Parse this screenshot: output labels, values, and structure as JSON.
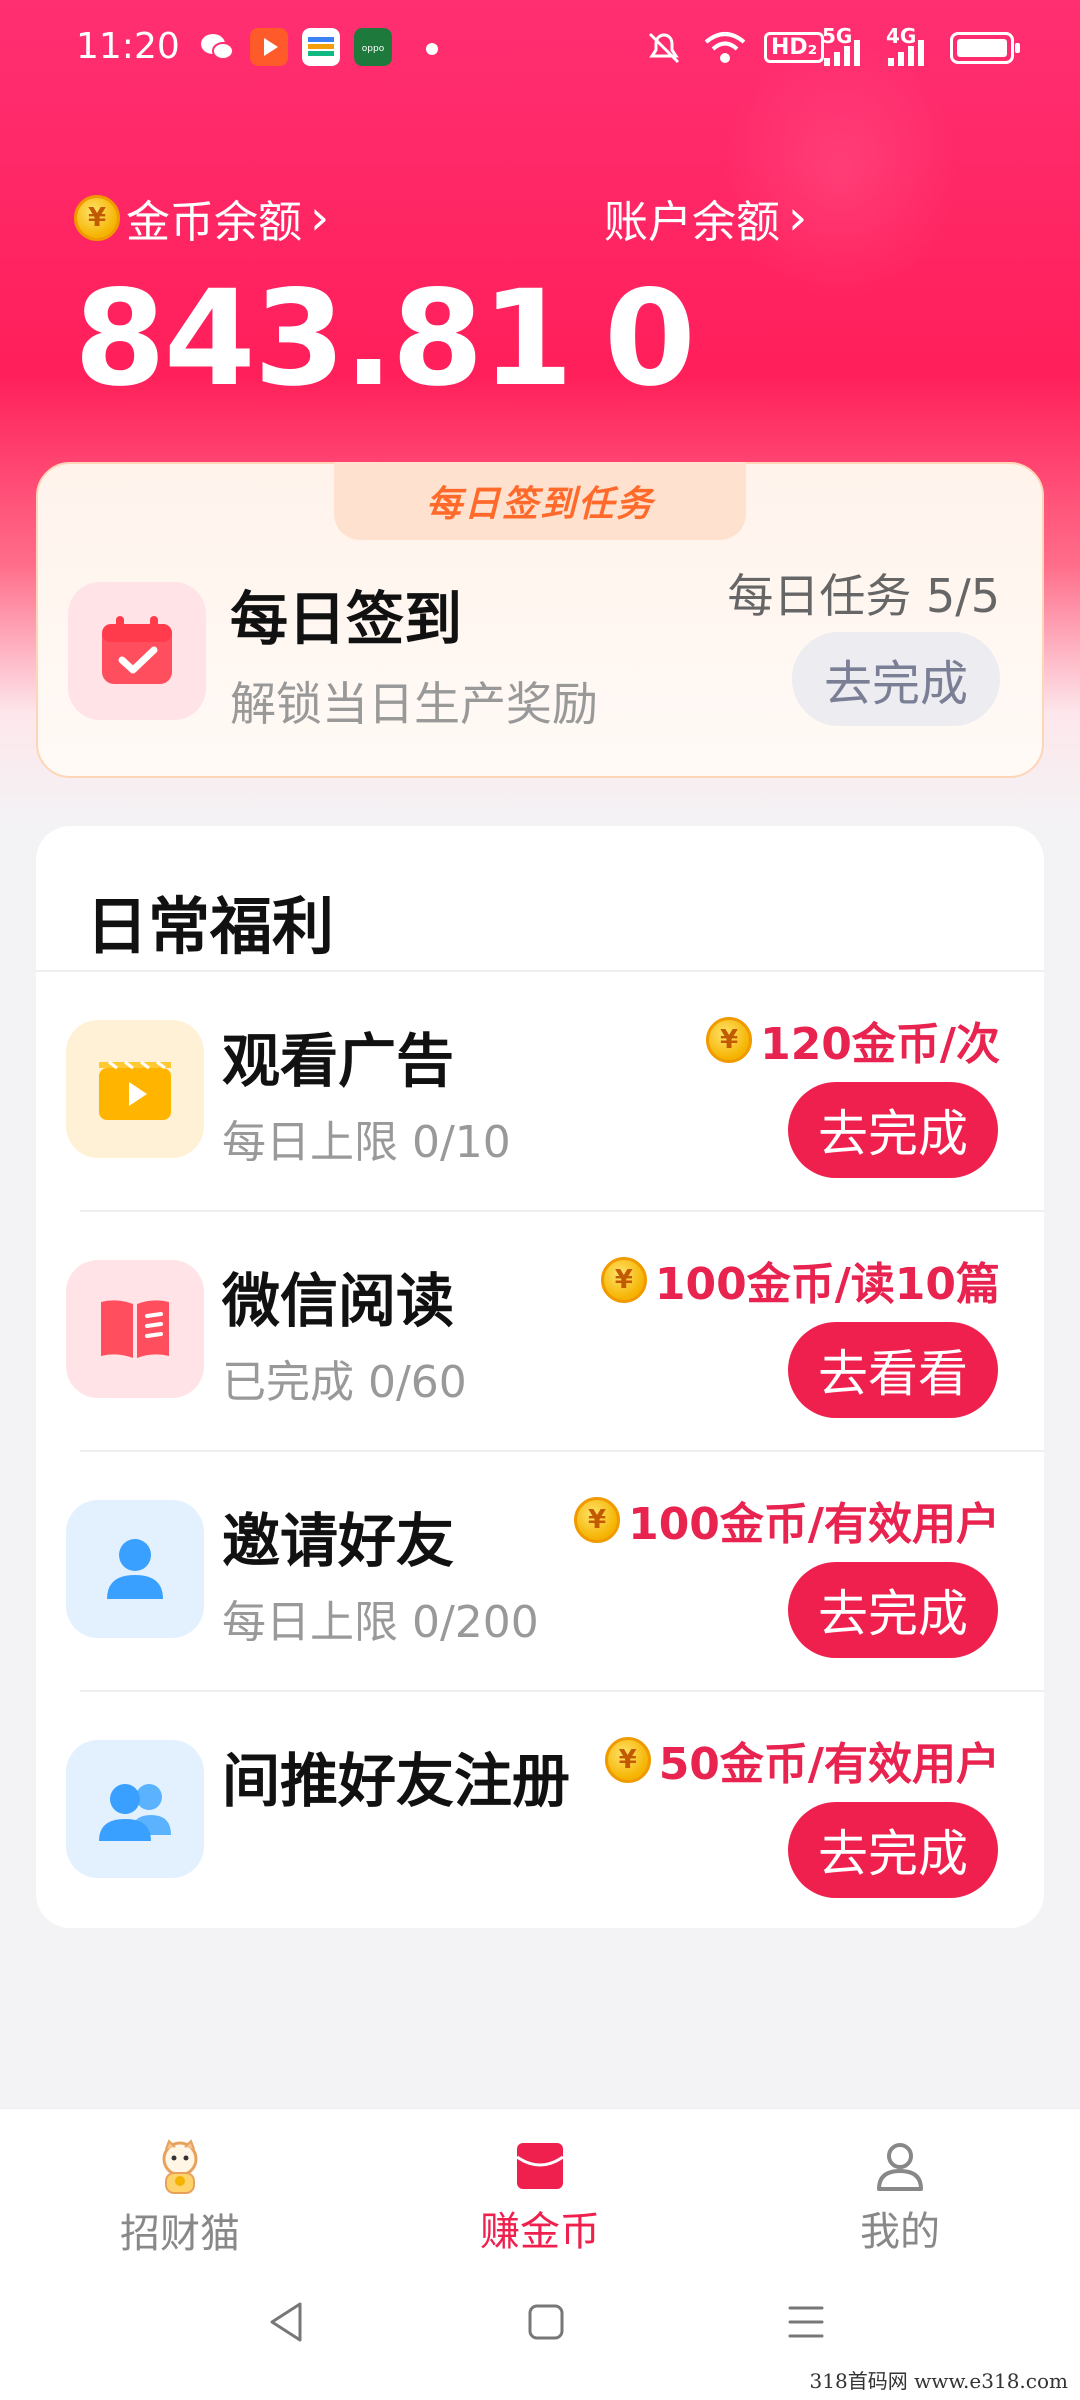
{
  "status_bar": {
    "time": "11:20",
    "indicators": [
      "HD₂",
      "5G",
      "4G"
    ],
    "apps": [
      "wechat",
      "video",
      "wallet",
      "oppo"
    ]
  },
  "balances": {
    "coin_label": "金币余额",
    "coin_value": "843.81",
    "account_label": "账户余额",
    "account_value": "0",
    "chevron": "›",
    "coin_symbol": "¥"
  },
  "daily_sign": {
    "banner": "每日签到任务",
    "title": "每日签到",
    "subtitle": "解锁当日生产奖励",
    "progress_text": "每日任务 5/5",
    "button": "去完成"
  },
  "welfare": {
    "title": "日常福利",
    "items": [
      {
        "title": "观看广告",
        "subtitle": "每日上限 0/10",
        "reward": "120金币/次",
        "button": "去完成",
        "icon": "video-icon",
        "icon_bg": "#fff1d6"
      },
      {
        "title": "微信阅读",
        "subtitle": "已完成 0/60",
        "reward": "100金币/读10篇",
        "button": "去看看",
        "icon": "book-icon",
        "icon_bg": "#ffe3e6"
      },
      {
        "title": "邀请好友",
        "subtitle": "每日上限 0/200",
        "reward": "100金币/有效用户",
        "button": "去完成",
        "icon": "user-icon",
        "icon_bg": "#e3f1ff"
      },
      {
        "title": "间推好友注册",
        "subtitle": "",
        "reward": "50金币/有效用户",
        "button": "去完成",
        "icon": "users-icon",
        "icon_bg": "#e3f1ff"
      }
    ]
  },
  "bottom_nav": {
    "items": [
      {
        "label": "招财猫",
        "icon": "lucky-cat-icon",
        "active": false
      },
      {
        "label": "赚金币",
        "icon": "envelope-icon",
        "active": true
      },
      {
        "label": "我的",
        "icon": "profile-icon",
        "active": false
      }
    ]
  },
  "colors": {
    "accent": "#f0204e",
    "brand_gradient_top": "#ff2f72",
    "coin": "#f5b300",
    "blue": "#3aa0ff"
  },
  "watermark": "318首码网  www.e318.com"
}
